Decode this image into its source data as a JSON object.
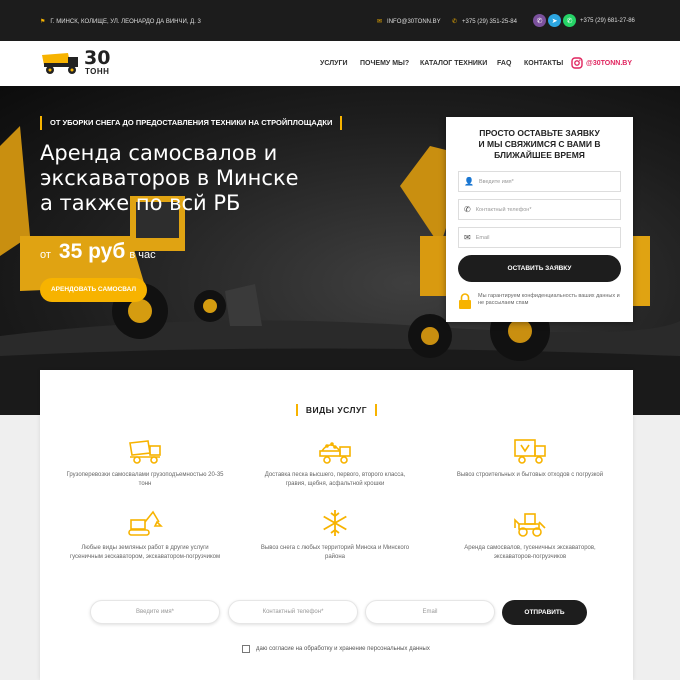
{
  "topbar": {
    "address": "Г. МИНСК, КОЛИЩЕ, УЛ. ЛЕОНАРДО ДА ВИНЧИ, Д. 3",
    "email": "INFO@30TONN.BY",
    "phone1": "+375 (29) 351-25-84",
    "phone2": "+375 (29) 681-27-86"
  },
  "nav": {
    "logo_number": "30",
    "logo_word": "ТОНН",
    "items": [
      "УСЛУГИ",
      "ПОЧЕМУ МЫ?",
      "КАТАЛОГ ТЕХНИКИ",
      "FAQ",
      "КОНТАКТЫ"
    ],
    "instagram": "@30TONN.BY"
  },
  "hero": {
    "tagline": "ОТ УБОРКИ СНЕГА ДО ПРЕДОСТАВЛЕНИЯ ТЕХНИКИ НА СТРОЙПЛОЩАДКИ",
    "title_line1": "Аренда самосвалов и",
    "title_line2": "экскаваторов в Минске",
    "title_line3": "а также по всй РБ",
    "price_from": "от",
    "price_value": "35 руб",
    "price_unit": "в час",
    "button": "АРЕНДОВАТЬ САМОСВАЛ"
  },
  "form": {
    "title_line1": "ПРОСТО ОСТАВЬТЕ ЗАЯВКУ",
    "title_line2": "И МЫ СВЯЖИМСЯ С ВАМИ В",
    "title_line3": "БЛИЖАЙШЕЕ ВРЕМЯ",
    "name_placeholder": "Введите имя*",
    "phone_placeholder": "Контактный телефон*",
    "email_placeholder": "Email",
    "submit": "ОСТАВИТЬ ЗАЯВКУ",
    "privacy_note": "Мы гарантируем конфиденциальность ваших данных и не рассылаем спам"
  },
  "services": {
    "title": "ВИДЫ УСЛУГ",
    "items": [
      {
        "icon": "dump-truck-icon",
        "text": "Грузоперевозки самосвалами грузоподъемностью 20-35 тонн"
      },
      {
        "icon": "sand-truck-icon",
        "text": "Доставка песка высшего, первого, второго класса, гравия, щебня, асфальтной крошки"
      },
      {
        "icon": "waste-truck-icon",
        "text": "Вывоз строительных и бытовых отходов с погрузкой"
      },
      {
        "icon": "excavator-icon",
        "text": "Любые виды земляных работ в другие услуги гусеничным экскаватором, экскаватором-погрузчиком"
      },
      {
        "icon": "snowflake-icon",
        "text": "Вывоз снега с любых территорий Минска и Минского района"
      },
      {
        "icon": "loader-icon",
        "text": "Аренда самосвалов, гусеничных экскаваторов, экскаваторов-погрузчиков"
      }
    ]
  },
  "bottom_form": {
    "name_placeholder": "Введите имя*",
    "phone_placeholder": "Контактный телефон*",
    "email_placeholder": "Email",
    "submit": "ОТПРАВИТЬ",
    "agree": "даю согласие на обработку и хранение персональных данных"
  },
  "colors": {
    "accent": "#f7b300",
    "dark": "#1d1d1d",
    "instagram": "#e0245e"
  }
}
